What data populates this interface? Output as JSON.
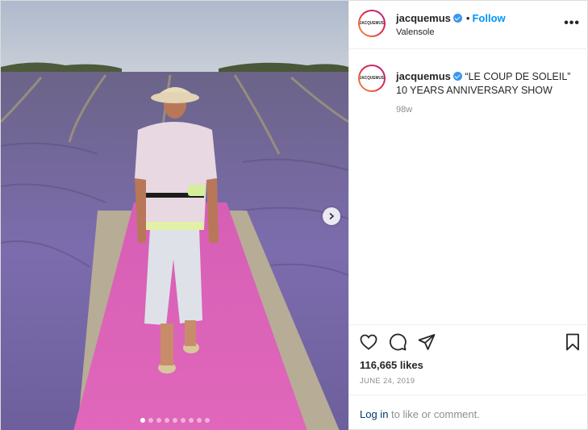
{
  "post": {
    "username": "jacquemus",
    "avatar_logo_text": "JACQUEMUS",
    "follow_label": "Follow",
    "bullet": "•",
    "location": "Valensole",
    "more_label": "•••",
    "caption_line1": "“LE COUP DE SOLEIL”",
    "caption_line2": "10 YEARS ANNIVERSARY SHOW",
    "caption_time": "98w",
    "likes": "116,665 likes",
    "date": "JUNE 24, 2019",
    "login_link": "Log in",
    "login_rest": " to like or comment.",
    "carousel": {
      "total": 9,
      "active_index": 0
    }
  },
  "icons": {
    "verified": "verified-badge-icon",
    "like": "heart-icon",
    "comment": "comment-bubble-icon",
    "share": "paper-plane-icon",
    "save": "bookmark-icon",
    "next": "chevron-right-icon"
  },
  "colors": {
    "follow": "#0095f6",
    "verified": "#3897f0",
    "runway": "#e060b8",
    "lavender": "#7d6fb6"
  }
}
